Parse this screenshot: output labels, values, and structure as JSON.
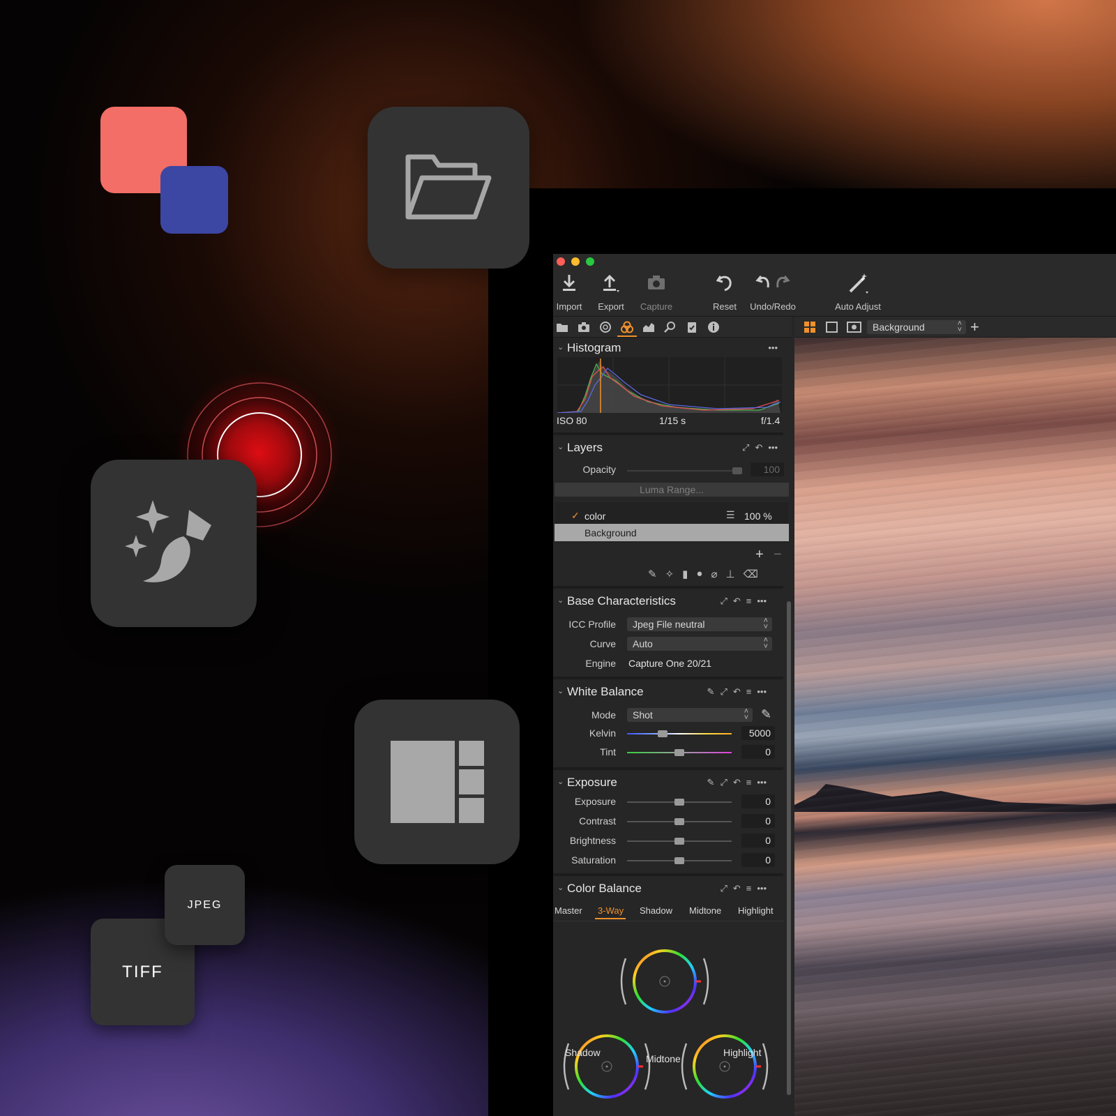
{
  "floating": {
    "tiff_label": "TIFF",
    "jpeg_label": "JPEG"
  },
  "colors": {
    "accent": "#f0912c",
    "tile_red": "#f26e66",
    "tile_blue": "#3c46a3",
    "record_red": "#e10e14",
    "close": "#fe5f57",
    "minimize": "#febc2e",
    "zoom": "#28c840"
  },
  "toolbar": {
    "import": "Import",
    "export": "Export",
    "capture": "Capture",
    "reset": "Reset",
    "undo_redo": "Undo/Redo",
    "auto_adjust": "Auto Adjust"
  },
  "viewer": {
    "layer_select": "Background"
  },
  "histogram": {
    "title": "Histogram",
    "iso": "ISO 80",
    "shutter": "1/15 s",
    "aperture": "f/1.4"
  },
  "layers": {
    "title": "Layers",
    "opacity_label": "Opacity",
    "opacity_value": "100",
    "luma_range": "Luma Range...",
    "items": [
      {
        "name": "color",
        "opacity": "100 %",
        "checked": true
      },
      {
        "name": "Background",
        "selected": true
      }
    ]
  },
  "base": {
    "title": "Base Characteristics",
    "icc_label": "ICC Profile",
    "icc_value": "Jpeg File neutral",
    "curve_label": "Curve",
    "curve_value": "Auto",
    "engine_label": "Engine",
    "engine_value": "Capture One 20/21"
  },
  "white_balance": {
    "title": "White Balance",
    "mode_label": "Mode",
    "mode_value": "Shot",
    "kelvin_label": "Kelvin",
    "kelvin_value": "5000",
    "tint_label": "Tint",
    "tint_value": "0"
  },
  "exposure": {
    "title": "Exposure",
    "rows": [
      {
        "label": "Exposure",
        "value": "0"
      },
      {
        "label": "Contrast",
        "value": "0"
      },
      {
        "label": "Brightness",
        "value": "0"
      },
      {
        "label": "Saturation",
        "value": "0"
      }
    ]
  },
  "color_balance": {
    "title": "Color Balance",
    "tabs": [
      "Master",
      "3-Way",
      "Shadow",
      "Midtone",
      "Highlight"
    ],
    "active_tab": "3-Way",
    "wheel_shadow": "Shadow",
    "wheel_midtone": "Midtone",
    "wheel_highlight": "Highlight"
  }
}
